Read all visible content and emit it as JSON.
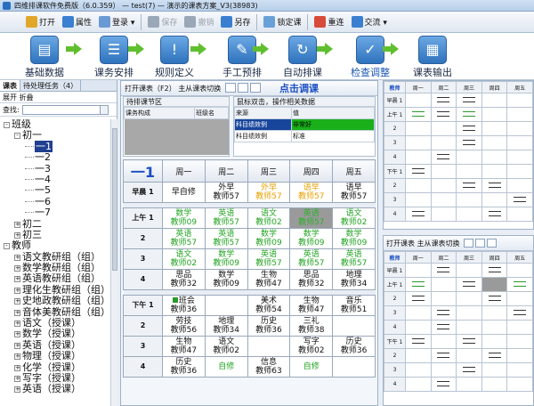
{
  "window": {
    "title": "四维排课软件免费版（6.0.359） — test(7) — 演示的课表方案_V3(38983)"
  },
  "toolbar": {
    "items": [
      {
        "label": "打开",
        "color": "#e0a72a",
        "enabled": true
      },
      {
        "label": "属性",
        "color": "#3a7fd0",
        "enabled": true
      },
      {
        "label": "登录 ▾",
        "color": "#6a9ad6",
        "enabled": true
      },
      {
        "label": "保存",
        "color": "#9aa7b6",
        "enabled": false
      },
      {
        "label": "撤销",
        "color": "#9aa7b6",
        "enabled": false
      },
      {
        "label": "另存",
        "color": "#3a7fd0",
        "enabled": true
      },
      {
        "label": "锁定课",
        "color": "#6aa0d8",
        "enabled": true
      },
      {
        "label": "重连",
        "color": "#d84a3a",
        "enabled": true
      },
      {
        "label": "交流 ▾",
        "color": "#3a7fd0",
        "enabled": true
      }
    ]
  },
  "workflow": {
    "steps": [
      {
        "label": "基础数据",
        "glyph": "▤"
      },
      {
        "label": "课务安排",
        "glyph": "☰"
      },
      {
        "label": "规则定义",
        "glyph": "!"
      },
      {
        "label": "手工预排",
        "glyph": "✎"
      },
      {
        "label": "自动排课",
        "glyph": "↻"
      },
      {
        "label": "检查调整",
        "glyph": "✓"
      },
      {
        "label": "课表输出",
        "glyph": "▦"
      }
    ]
  },
  "left_panel": {
    "tabs": [
      "课表",
      "待处理任务（4）"
    ],
    "buttons": "展开  折叠",
    "search_label": "查找:",
    "tree": [
      {
        "label": "班级",
        "indent": 0,
        "exp": "-"
      },
      {
        "label": "初一",
        "indent": 1,
        "exp": "-"
      },
      {
        "label": "一1",
        "indent": 2,
        "exp": "",
        "selected": true
      },
      {
        "label": "一2",
        "indent": 2,
        "exp": ""
      },
      {
        "label": "一3",
        "indent": 2,
        "exp": ""
      },
      {
        "label": "一4",
        "indent": 2,
        "exp": ""
      },
      {
        "label": "一5",
        "indent": 2,
        "exp": ""
      },
      {
        "label": "一6",
        "indent": 2,
        "exp": ""
      },
      {
        "label": "一7",
        "indent": 2,
        "exp": ""
      },
      {
        "label": "初二",
        "indent": 1,
        "exp": "+"
      },
      {
        "label": "初三",
        "indent": 1,
        "exp": "+"
      },
      {
        "label": "教师",
        "indent": 0,
        "exp": "-"
      },
      {
        "label": "语文教研组（组）",
        "indent": 1,
        "exp": "+"
      },
      {
        "label": "数学教研组（组）",
        "indent": 1,
        "exp": "+"
      },
      {
        "label": "英语教研组（组）",
        "indent": 1,
        "exp": "+"
      },
      {
        "label": "理化生教研组（组）",
        "indent": 1,
        "exp": "+"
      },
      {
        "label": "史地政教研组（组）",
        "indent": 1,
        "exp": "+"
      },
      {
        "label": "音体美教研组（组）",
        "indent": 1,
        "exp": "+"
      },
      {
        "label": "语文（授课）",
        "indent": 1,
        "exp": "+"
      },
      {
        "label": "数学（授课）",
        "indent": 1,
        "exp": "+"
      },
      {
        "label": "英语（授课）",
        "indent": 1,
        "exp": "+"
      },
      {
        "label": "物理（授课）",
        "indent": 1,
        "exp": "+"
      },
      {
        "label": "化学（授课）",
        "indent": 1,
        "exp": "+"
      },
      {
        "label": "写字（授课）",
        "indent": 1,
        "exp": "+"
      },
      {
        "label": "英语（授课）",
        "indent": 1,
        "exp": "+"
      }
    ]
  },
  "center": {
    "header": "打开课表（F2）  主从课表切换",
    "hot_label": "点击调课",
    "pending": {
      "title": "待排课节区",
      "cols": [
        "课务构成",
        "班级名"
      ]
    },
    "info": {
      "title": "鼠标双击，操作相关数据",
      "cols": [
        "来源",
        "值"
      ],
      "rows": [
        [
          "科目绩效例",
          "非常好"
        ],
        [
          "科目绩效例",
          "标准"
        ]
      ]
    },
    "schedule": {
      "corner": "一1",
      "days": [
        "周一",
        "周二",
        "周三",
        "周四",
        "周五"
      ],
      "rows": [
        {
          "label": "早晨 1",
          "cells": [
            [
              "早自修",
              "",
              "black"
            ],
            [
              "外早",
              "教师57",
              "black"
            ],
            [
              "外早",
              "教师57",
              "orange"
            ],
            [
              "语早",
              "教师57",
              "orange"
            ],
            [
              "语早",
              "教师57",
              "black"
            ]
          ]
        },
        {
          "gap": true
        },
        {
          "label": "上午 1",
          "cells": [
            [
              "数学",
              "教师09",
              "green"
            ],
            [
              "英语",
              "教师57",
              "green"
            ],
            [
              "语文",
              "教师02",
              "green"
            ],
            [
              "英语",
              "教师57",
              "green",
              "sel"
            ],
            [
              "语文",
              "教师02",
              "green"
            ]
          ]
        },
        {
          "label": "2",
          "cells": [
            [
              "英语",
              "教师57",
              "green"
            ],
            [
              "英语",
              "教师57",
              "green"
            ],
            [
              "数学",
              "教师09",
              "green"
            ],
            [
              "数学",
              "教师09",
              "green"
            ],
            [
              "数学",
              "教师09",
              "green"
            ]
          ]
        },
        {
          "label": "3",
          "cells": [
            [
              "语文",
              "教师02",
              "green"
            ],
            [
              "数学",
              "教师09",
              "green"
            ],
            [
              "英语",
              "教师57",
              "green"
            ],
            [
              "英语",
              "教师57",
              "green"
            ],
            [
              "英语",
              "教师57",
              "green"
            ]
          ]
        },
        {
          "label": "4",
          "cells": [
            [
              "思品",
              "教师32",
              "black"
            ],
            [
              "数学",
              "教师09",
              "black"
            ],
            [
              "生物",
              "教师47",
              "black"
            ],
            [
              "思品",
              "教师32",
              "black"
            ],
            [
              "地理",
              "教师34",
              "black"
            ]
          ]
        },
        {
          "gap": true
        },
        {
          "label": "下午 1",
          "cells": [
            [
              "班会",
              "教师36",
              "black",
              "flag"
            ],
            [
              "",
              "",
              "black"
            ],
            [
              "美术",
              "教师54",
              "black"
            ],
            [
              "生物",
              "教师47",
              "black"
            ],
            [
              "音乐",
              "教师51",
              "black"
            ]
          ]
        },
        {
          "label": "2",
          "cells": [
            [
              "劳技",
              "教师56",
              "black"
            ],
            [
              "地理",
              "教师34",
              "black"
            ],
            [
              "历史",
              "教师36",
              "black"
            ],
            [
              "三礼",
              "教师38",
              "black"
            ],
            [
              "",
              "",
              "black"
            ]
          ]
        },
        {
          "label": "3",
          "cells": [
            [
              "生物",
              "教师47",
              "black"
            ],
            [
              "语文",
              "教师02",
              "black"
            ],
            [
              "",
              "",
              "black"
            ],
            [
              "写字",
              "教师02",
              "black"
            ],
            [
              "历史",
              "教师36",
              "black"
            ]
          ]
        },
        {
          "label": "4",
          "cells": [
            [
              "历史",
              "教师36",
              "black"
            ],
            [
              "自修",
              "",
              "green"
            ],
            [
              "信息",
              "教师63",
              "black"
            ],
            [
              "自修",
              "",
              "green"
            ],
            [
              "",
              "",
              "black"
            ]
          ]
        }
      ]
    }
  },
  "right_top": {
    "corner": "教师",
    "days": [
      "周一",
      "周二",
      "周三",
      "周四",
      "周五"
    ],
    "row_labels": [
      "早晨 1",
      "上午 1",
      "2",
      "3",
      "4",
      "下午 1",
      "2",
      "3",
      "4"
    ]
  },
  "right_bottom": {
    "header": "打开课表  主从课表切换",
    "corner": "教师",
    "days": [
      "周一",
      "周二",
      "周三",
      "周四",
      "周五"
    ],
    "row_labels": [
      "早晨 1",
      "上午 1",
      "2",
      "3",
      "4",
      "下午 1",
      "2",
      "3",
      "4"
    ]
  },
  "colors": {
    "green": "#22a322",
    "orange": "#e8a100",
    "accent": "#1b4fc2"
  }
}
